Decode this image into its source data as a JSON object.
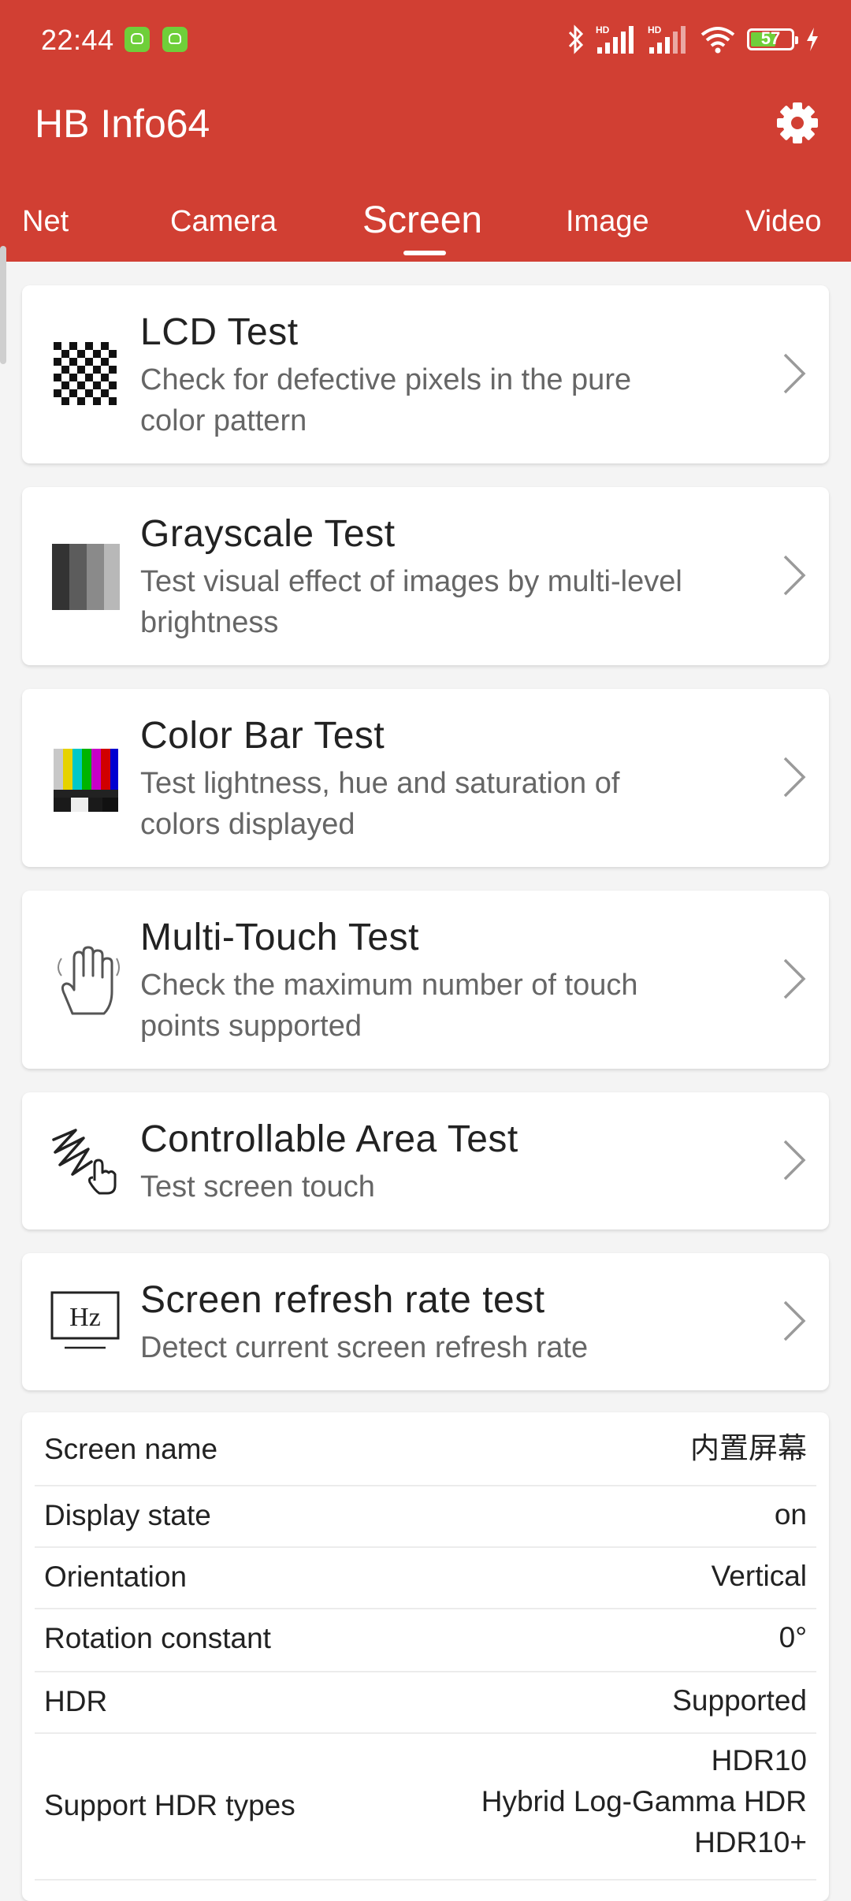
{
  "status_bar": {
    "time": "22:44",
    "battery": "57",
    "icons": [
      "bluetooth-icon",
      "hd-signal-icon",
      "hd-signal-icon",
      "wifi-icon",
      "battery-icon",
      "charging-icon"
    ]
  },
  "app": {
    "title": "HB Info64",
    "brand_color": "#d13f33"
  },
  "tabs": [
    {
      "label": "Net"
    },
    {
      "label": "Camera"
    },
    {
      "label": "Screen",
      "active": true
    },
    {
      "label": "Image"
    },
    {
      "label": "Video"
    }
  ],
  "tests": [
    {
      "title": "LCD Test",
      "subtitle_1": "Check for defective pixels in the pure",
      "subtitle_2": "color pattern",
      "icon": "checkerboard-icon"
    },
    {
      "title": "Grayscale Test",
      "subtitle_1": "Test visual effect of images by multi-level",
      "subtitle_2": "brightness",
      "icon": "grayscale-icon"
    },
    {
      "title": "Color Bar Test",
      "subtitle_1": "Test lightness, hue and saturation of",
      "subtitle_2": "colors displayed",
      "icon": "color-bars-icon"
    },
    {
      "title": "Multi-Touch Test",
      "subtitle_1": "Check the maximum number of touch",
      "subtitle_2": "points supported",
      "icon": "hand-icon"
    },
    {
      "title": "Controllable Area Test",
      "subtitle_1": "Test screen touch",
      "icon": "scribble-touch-icon"
    },
    {
      "title": "Screen refresh rate test",
      "subtitle_1": "Detect current screen refresh rate",
      "icon": "hz-icon",
      "icon_text": "Hz"
    }
  ],
  "screen_info": [
    {
      "label": "Screen name",
      "value": "内置屏幕"
    },
    {
      "label": "Display state",
      "value": "on"
    },
    {
      "label": "Orientation",
      "value": "Vertical"
    },
    {
      "label": "Rotation constant",
      "value": "0°"
    },
    {
      "label": "HDR",
      "value": "Supported"
    },
    {
      "label": "Support HDR types",
      "value_1": "HDR10",
      "value_2": "Hybrid Log-Gamma HDR",
      "value_3": "HDR10+"
    }
  ]
}
